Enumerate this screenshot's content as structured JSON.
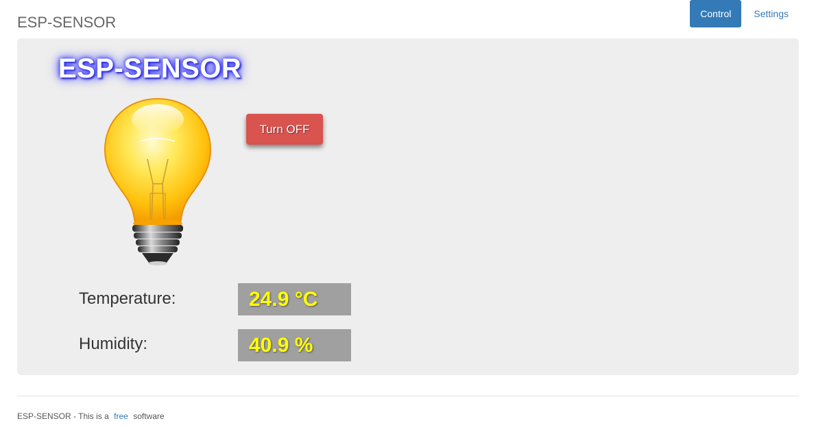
{
  "header": {
    "brand": "ESP-SENSOR",
    "nav": [
      {
        "label": "Control",
        "active": true
      },
      {
        "label": "Settings",
        "active": false
      }
    ]
  },
  "main": {
    "title": "ESP-SENSOR",
    "toggle_button_label": "Turn OFF",
    "bulb_state": "on",
    "readings": [
      {
        "label": "Temperature:",
        "value": "24.9 °C"
      },
      {
        "label": "Humidity:",
        "value": "40.9 %"
      }
    ]
  },
  "footer": {
    "prefix": "ESP-SENSOR - This is a",
    "link": "free",
    "suffix": "software"
  },
  "colors": {
    "nav_active": "#337ab7",
    "button_danger": "#d9534f",
    "value_text": "#ffff00",
    "value_bg": "#a0a0a0"
  }
}
